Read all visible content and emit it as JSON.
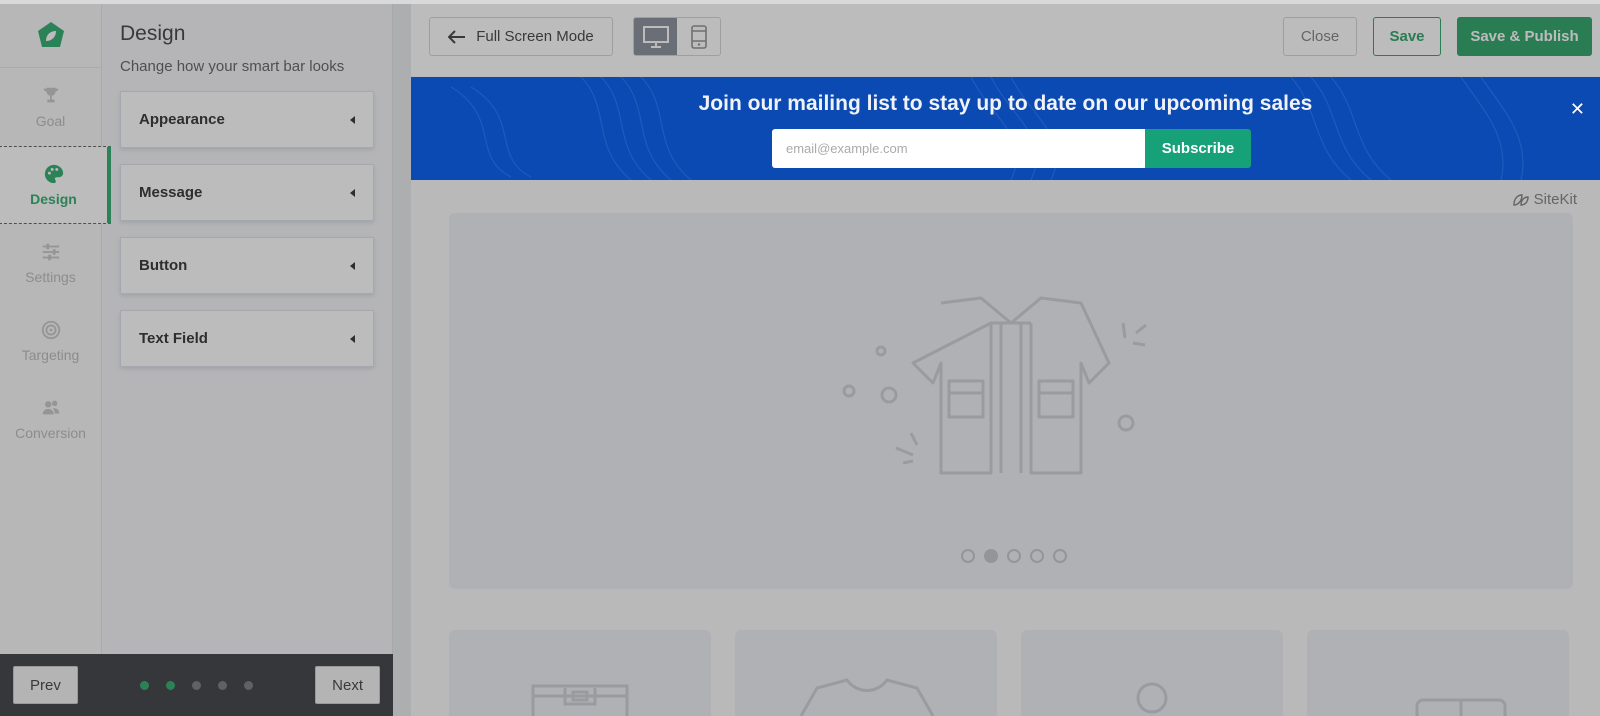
{
  "rail": {
    "items": [
      {
        "label": "Goal",
        "icon": "trophy-icon"
      },
      {
        "label": "Design",
        "icon": "palette-icon",
        "active": true
      },
      {
        "label": "Settings",
        "icon": "sliders-icon"
      },
      {
        "label": "Targeting",
        "icon": "target-icon"
      },
      {
        "label": "Conversion",
        "icon": "users-icon"
      }
    ]
  },
  "panel": {
    "title": "Design",
    "subtitle": "Change how your smart bar looks",
    "sections": [
      "Appearance",
      "Message",
      "Button",
      "Text Field"
    ]
  },
  "bottom_nav": {
    "prev_label": "Prev",
    "next_label": "Next",
    "steps_total": 5,
    "steps_completed": 2
  },
  "toolbar": {
    "full_screen_label": "Full Screen Mode",
    "device_selected": "desktop",
    "close_label": "Close",
    "save_label": "Save",
    "publish_label": "Save & Publish"
  },
  "smart_bar": {
    "message": "Join our mailing list to stay up to date on our upcoming sales",
    "email_placeholder": "email@example.com",
    "button_label": "Subscribe",
    "close_glyph": "✕",
    "background_color": "#0a4ab2",
    "button_color": "#16a179"
  },
  "preview": {
    "brand": "SiteKit",
    "carousel_slides": 5,
    "carousel_active": 2
  },
  "colors": {
    "accent": "#1fa462",
    "publish": "#1b9b5c",
    "bottom_bar": "#2c2f36"
  }
}
